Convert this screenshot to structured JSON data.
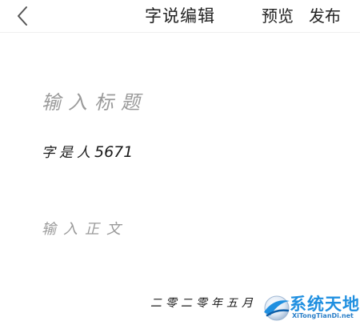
{
  "header": {
    "title": "字说编辑",
    "preview_label": "预览",
    "publish_label": "发布"
  },
  "editor": {
    "title_placeholder": "输入标题",
    "author_label": "字是人",
    "author_number": "5671",
    "body_placeholder": "输入正文",
    "date": "二零二零年五月"
  },
  "watermark": {
    "brand": "系统天地",
    "site": "XiTongTianDi.net"
  },
  "colors": {
    "text": "#222222",
    "placeholder": "#9a9a9a",
    "watermark": "#1f8fe0"
  },
  "icons": {
    "back": "chevron-left-icon",
    "watermark_logo": "globe-swoosh-icon"
  }
}
